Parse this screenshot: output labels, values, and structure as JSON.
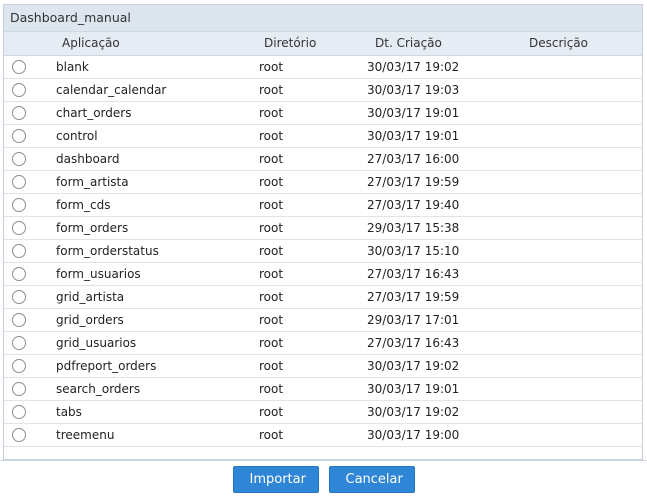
{
  "panel": {
    "title": "Dashboard_manual"
  },
  "columns": {
    "app": "Aplicação",
    "dir": "Diretório",
    "created": "Dt. Criação",
    "desc": "Descrição"
  },
  "rows": [
    {
      "app": "blank",
      "dir": "root",
      "created": "30/03/17 19:02",
      "desc": ""
    },
    {
      "app": "calendar_calendar",
      "dir": "root",
      "created": "30/03/17 19:03",
      "desc": ""
    },
    {
      "app": "chart_orders",
      "dir": "root",
      "created": "30/03/17 19:01",
      "desc": ""
    },
    {
      "app": "control",
      "dir": "root",
      "created": "30/03/17 19:01",
      "desc": ""
    },
    {
      "app": "dashboard",
      "dir": "root",
      "created": "27/03/17 16:00",
      "desc": ""
    },
    {
      "app": "form_artista",
      "dir": "root",
      "created": "27/03/17 19:59",
      "desc": ""
    },
    {
      "app": "form_cds",
      "dir": "root",
      "created": "27/03/17 19:40",
      "desc": ""
    },
    {
      "app": "form_orders",
      "dir": "root",
      "created": "29/03/17 15:38",
      "desc": ""
    },
    {
      "app": "form_orderstatus",
      "dir": "root",
      "created": "30/03/17 15:10",
      "desc": ""
    },
    {
      "app": "form_usuarios",
      "dir": "root",
      "created": "27/03/17 16:43",
      "desc": ""
    },
    {
      "app": "grid_artista",
      "dir": "root",
      "created": "27/03/17 19:59",
      "desc": ""
    },
    {
      "app": "grid_orders",
      "dir": "root",
      "created": "29/03/17 17:01",
      "desc": ""
    },
    {
      "app": "grid_usuarios",
      "dir": "root",
      "created": "27/03/17 16:43",
      "desc": ""
    },
    {
      "app": "pdfreport_orders",
      "dir": "root",
      "created": "30/03/17 19:02",
      "desc": ""
    },
    {
      "app": "search_orders",
      "dir": "root",
      "created": "30/03/17 19:01",
      "desc": ""
    },
    {
      "app": "tabs",
      "dir": "root",
      "created": "30/03/17 19:02",
      "desc": ""
    },
    {
      "app": "treemenu",
      "dir": "root",
      "created": "30/03/17 19:00",
      "desc": ""
    }
  ],
  "buttons": {
    "import": "Importar",
    "cancel": "Cancelar"
  },
  "colors": {
    "button_bg": "#2f86d6",
    "header_bg": "#dde5ee"
  }
}
